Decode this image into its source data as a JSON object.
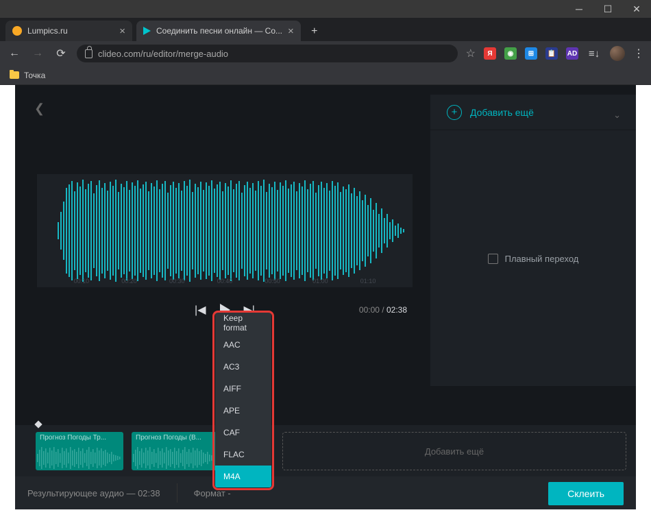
{
  "tabs": {
    "inactive": "Lumpics.ru",
    "active": "Соединить песни онлайн — Со..."
  },
  "url": "clideo.com/ru/editor/merge-audio",
  "bookmark": "Точка",
  "rightPanel": {
    "addMore": "Добавить ещё",
    "crossfade": "Плавный переход"
  },
  "ruler": [
    "00:10",
    "00:20",
    "00:30",
    "00:40",
    "00:50",
    "01:00",
    "01:10"
  ],
  "player": {
    "current": "00:00",
    "total": "02:38"
  },
  "clips": {
    "c1": "Прогноз Погоды Тр...",
    "c2": "Прогноз Погоды (В..."
  },
  "addMoreDashed": "Добавить ещё",
  "bottomBar": {
    "resultLabel": "Результирующее аудио",
    "resultTime": "02:38",
    "formatLabel": "Формат"
  },
  "mergeBtn": "Склеить",
  "formats": {
    "f0": "Keep format",
    "f1": "AAC",
    "f2": "AC3",
    "f3": "AIFF",
    "f4": "APE",
    "f5": "CAF",
    "f6": "FLAC",
    "f7": "M4A"
  }
}
